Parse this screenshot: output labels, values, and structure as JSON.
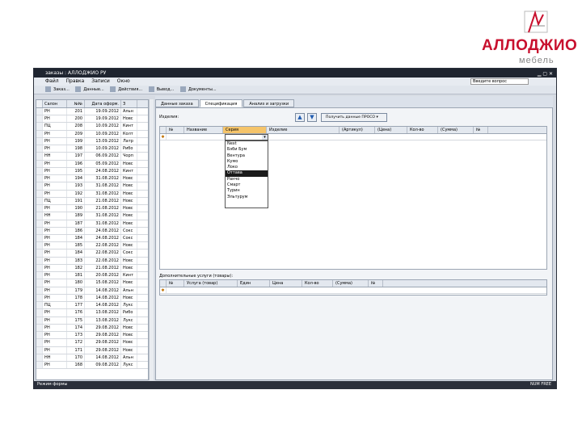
{
  "logo": {
    "brand": "АЛЛОДЖИО",
    "sub": "мебель"
  },
  "window": {
    "title": "заказы : АЛЛОДЖИО РУ",
    "menu": [
      "Файл",
      "Правка",
      "Записи",
      "Окно"
    ],
    "search_value": "Введите вопрос",
    "toolbar": [
      "Заказ...",
      "Данные...",
      "Действия...",
      "Вывод...",
      "Документы..."
    ],
    "status_left": "Режим формы",
    "status_right": "NUM FREE"
  },
  "left_grid": {
    "headers": [
      "Салон",
      "№№",
      "Дата оформ.",
      "З"
    ],
    "rows": [
      [
        "РН",
        "201",
        "19.09.2012",
        "Альн"
      ],
      [
        "РН",
        "200",
        "19.09.2012",
        "Новс"
      ],
      [
        "ПЦ",
        "208",
        "10.09.2012",
        "Кинт"
      ],
      [
        "РН",
        "209",
        "10.09.2012",
        "Колт"
      ],
      [
        "РН",
        "199",
        "13.09.2012",
        "Латр"
      ],
      [
        "РН",
        "198",
        "10.09.2012",
        "Рибо"
      ],
      [
        "НН",
        "197",
        "06.09.2012",
        "Чорп"
      ],
      [
        "РН",
        "196",
        "05.09.2012",
        "Новс"
      ],
      [
        "РН",
        "195",
        "24.08.2012",
        "Кинт"
      ],
      [
        "РН",
        "194",
        "31.08.2012",
        "Новс"
      ],
      [
        "РН",
        "193",
        "31.08.2012",
        "Новс"
      ],
      [
        "РН",
        "192",
        "31.08.2012",
        "Новс"
      ],
      [
        "ПЦ",
        "191",
        "21.08.2012",
        "Новс"
      ],
      [
        "РН",
        "190",
        "21.08.2012",
        "Новс"
      ],
      [
        "НН",
        "189",
        "31.08.2012",
        "Новс"
      ],
      [
        "РН",
        "187",
        "31.08.2012",
        "Новс"
      ],
      [
        "РН",
        "186",
        "24.08.2012",
        "Сокс"
      ],
      [
        "РН",
        "184",
        "24.08.2012",
        "Сокс"
      ],
      [
        "РН",
        "185",
        "22.08.2012",
        "Новс"
      ],
      [
        "РН",
        "184",
        "22.08.2012",
        "Сокс"
      ],
      [
        "РН",
        "183",
        "22.08.2012",
        "Новс"
      ],
      [
        "РН",
        "182",
        "21.08.2012",
        "Новс"
      ],
      [
        "РН",
        "181",
        "20.08.2012",
        "Кинт"
      ],
      [
        "РН",
        "180",
        "15.08.2012",
        "Новс"
      ],
      [
        "РН",
        "179",
        "14.08.2012",
        "Альн"
      ],
      [
        "РН",
        "178",
        "14.08.2012",
        "Новс"
      ],
      [
        "ПЦ",
        "177",
        "14.08.2012",
        "Лукс"
      ],
      [
        "РН",
        "176",
        "13.08.2012",
        "Рибо"
      ],
      [
        "РН",
        "175",
        "13.08.2012",
        "Лукс"
      ],
      [
        "РН",
        "174",
        "29.08.2012",
        "Новс"
      ],
      [
        "РН",
        "173",
        "29.08.2012",
        "Новс"
      ],
      [
        "РН",
        "172",
        "29.08.2012",
        "Новс"
      ],
      [
        "РН",
        "171",
        "29.08.2012",
        "Новс"
      ],
      [
        "НН",
        "170",
        "14.08.2012",
        "Альн"
      ],
      [
        "РН",
        "168",
        "09.08.2012",
        "Лукс"
      ]
    ]
  },
  "tabs": [
    "Данные заказа",
    "Спецификация",
    "Анализ и загрузки"
  ],
  "spec": {
    "label_products": "Изделия:",
    "fetch_button": "Получить данные ПРОСО",
    "headers": [
      "№",
      "Название",
      "Серия",
      "Изделие",
      "(Артикул)",
      "(Цена)",
      "Кол-во",
      "(Сумма)",
      "№"
    ],
    "series_options": [
      "Next",
      "Бэби Бум",
      "Вентура",
      "Кумо",
      "Локо",
      "Оттава",
      "Ранчо",
      "Смарт",
      "Турин",
      "Эльтурум"
    ],
    "selected_series": "Оттава",
    "label_extra": "Дополнительные услуги (товары):",
    "extra_headers": [
      "№",
      "Услуга (товар)",
      "Един",
      "Цена",
      "Кол-во",
      "(Сумма)",
      "№"
    ]
  }
}
